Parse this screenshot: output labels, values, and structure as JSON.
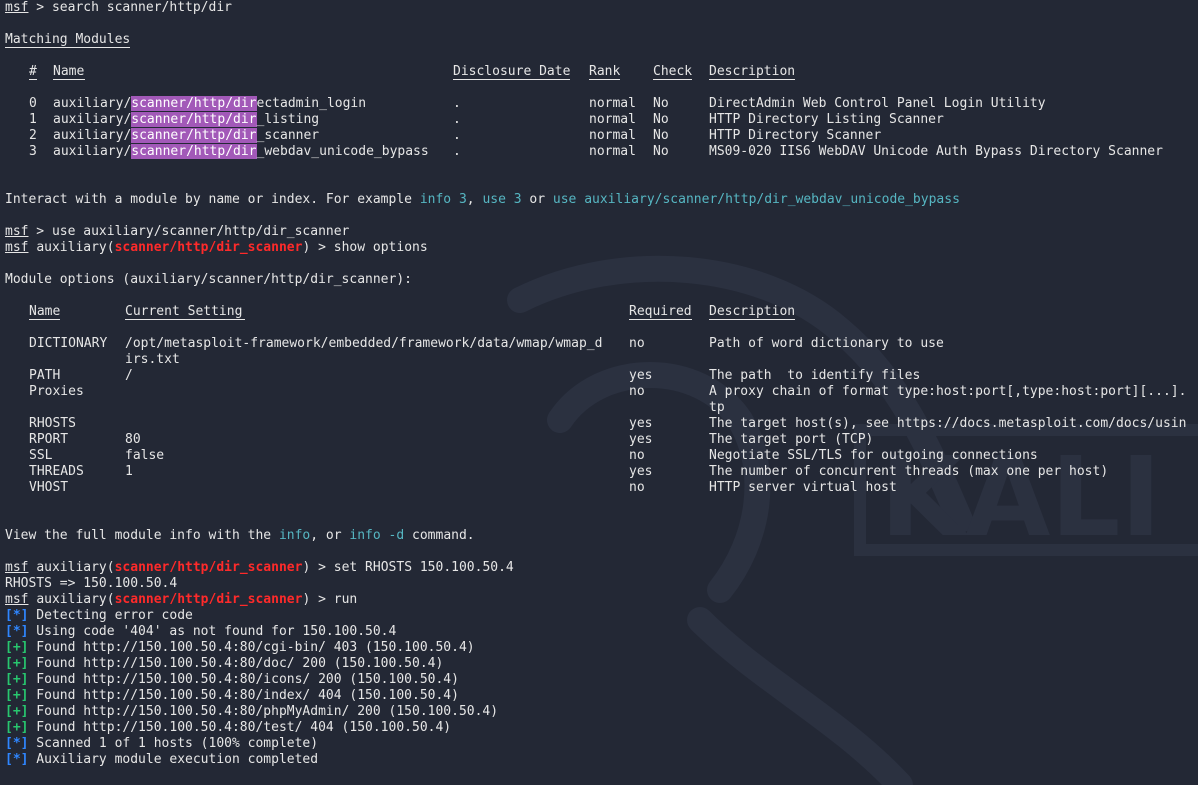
{
  "prompt": {
    "label": "msf",
    "module": "scanner/http/dir_scanner",
    "module_prefix": "auxiliary(",
    "module_suffix": ")",
    "arrow": " > "
  },
  "commands": {
    "search": "search scanner/http/dir",
    "use": "use auxiliary/scanner/http/dir_scanner",
    "show": "show options",
    "set": "set RHOSTS 150.100.50.4",
    "run": "run"
  },
  "search_results": {
    "title": "Matching Modules",
    "underline": "================",
    "headers": {
      "num": "#",
      "name": "Name",
      "date": "Disclosure Date",
      "rank": "Rank",
      "check": "Check",
      "desc": "Description"
    },
    "header_dash": "-",
    "highlight": "scanner/http/dir",
    "rows": [
      {
        "num": "0",
        "prefix": "auxiliary/",
        "match": "scanner/http/dir",
        "rest": "ectadmin_login",
        "date": ".",
        "rank": "normal",
        "check": "No",
        "desc": "DirectAdmin Web Control Panel Login Utility"
      },
      {
        "num": "1",
        "prefix": "auxiliary/",
        "match": "scanner/http/dir",
        "rest": "_listing",
        "date": ".",
        "rank": "normal",
        "check": "No",
        "desc": "HTTP Directory Listing Scanner"
      },
      {
        "num": "2",
        "prefix": "auxiliary/",
        "match": "scanner/http/dir",
        "rest": "_scanner",
        "date": ".",
        "rank": "normal",
        "check": "No",
        "desc": "HTTP Directory Scanner"
      },
      {
        "num": "3",
        "prefix": "auxiliary/",
        "match": "scanner/http/dir",
        "rest": "_webdav_unicode_bypass",
        "date": ".",
        "rank": "normal",
        "check": "No",
        "desc": "MS09-020 IIS6 WebDAV Unicode Auth Bypass Directory Scanner"
      }
    ]
  },
  "interact_hint": {
    "text1": "Interact with a module by name or index. For example ",
    "link1": "info 3",
    "text2": ", ",
    "link2": "use 3",
    "text3": " or ",
    "link3": "use auxiliary/scanner/http/dir_webdav_unicode_bypass"
  },
  "options": {
    "title": "Module options (auxiliary/scanner/http/dir_scanner):",
    "headers": {
      "name": "Name",
      "setting": "Current Setting",
      "required": "Required",
      "desc": "Description"
    },
    "rows": [
      {
        "name": "DICTIONARY",
        "setting": "/opt/metasploit-framework/embedded/framework/data/wmap/wmap_d",
        "setting2": "irs.txt",
        "required": "no",
        "desc": "Path of word dictionary to use",
        "desc2": ""
      },
      {
        "name": "PATH",
        "setting": "/",
        "setting2": "",
        "required": "yes",
        "desc": "The path  to identify files",
        "desc2": ""
      },
      {
        "name": "Proxies",
        "setting": "",
        "setting2": "",
        "required": "no",
        "desc": "A proxy chain of format type:host:port[,type:host:port][...].",
        "desc2": "tp"
      },
      {
        "name": "RHOSTS",
        "setting": "",
        "setting2": "",
        "required": "yes",
        "desc": "The target host(s), see https://docs.metasploit.com/docs/usin",
        "desc2": ""
      },
      {
        "name": "RPORT",
        "setting": "80",
        "setting2": "",
        "required": "yes",
        "desc": "The target port (TCP)",
        "desc2": ""
      },
      {
        "name": "SSL",
        "setting": "false",
        "setting2": "",
        "required": "no",
        "desc": "Negotiate SSL/TLS for outgoing connections",
        "desc2": ""
      },
      {
        "name": "THREADS",
        "setting": "1",
        "setting2": "",
        "required": "yes",
        "desc": "The number of concurrent threads (max one per host)",
        "desc2": ""
      },
      {
        "name": "VHOST",
        "setting": "",
        "setting2": "",
        "required": "no",
        "desc": "HTTP server virtual host",
        "desc2": ""
      }
    ]
  },
  "info_hint": {
    "text1": "View the full module info with the ",
    "link1": "info",
    "text2": ", or ",
    "link2": "info -d",
    "text3": " command."
  },
  "set_output": "RHOSTS => 150.100.50.4",
  "run_output": [
    {
      "tag": "[*]",
      "type": "info",
      "text": " Detecting error code"
    },
    {
      "tag": "[*]",
      "type": "info",
      "text": " Using code '404' as not found for 150.100.50.4"
    },
    {
      "tag": "[+]",
      "type": "good",
      "text": " Found http://150.100.50.4:80/cgi-bin/ 403 (150.100.50.4)"
    },
    {
      "tag": "[+]",
      "type": "good",
      "text": " Found http://150.100.50.4:80/doc/ 200 (150.100.50.4)"
    },
    {
      "tag": "[+]",
      "type": "good",
      "text": " Found http://150.100.50.4:80/icons/ 200 (150.100.50.4)"
    },
    {
      "tag": "[+]",
      "type": "good",
      "text": " Found http://150.100.50.4:80/index/ 404 (150.100.50.4)"
    },
    {
      "tag": "[+]",
      "type": "good",
      "text": " Found http://150.100.50.4:80/phpMyAdmin/ 200 (150.100.50.4)"
    },
    {
      "tag": "[+]",
      "type": "good",
      "text": " Found http://150.100.50.4:80/test/ 404 (150.100.50.4)"
    },
    {
      "tag": "[*]",
      "type": "info",
      "text": " Scanned 1 of 1 hosts (100% complete)"
    },
    {
      "tag": "[*]",
      "type": "info",
      "text": " Auxiliary module execution completed"
    }
  ],
  "watermark": {
    "text": "KALI"
  },
  "colors": {
    "background": "#232835",
    "prompt_module": "#ff2a2a",
    "link": "#56b6c2",
    "highlight": "#a259b8",
    "info_tag": "#2f86ff",
    "good_tag": "#28c76f"
  }
}
